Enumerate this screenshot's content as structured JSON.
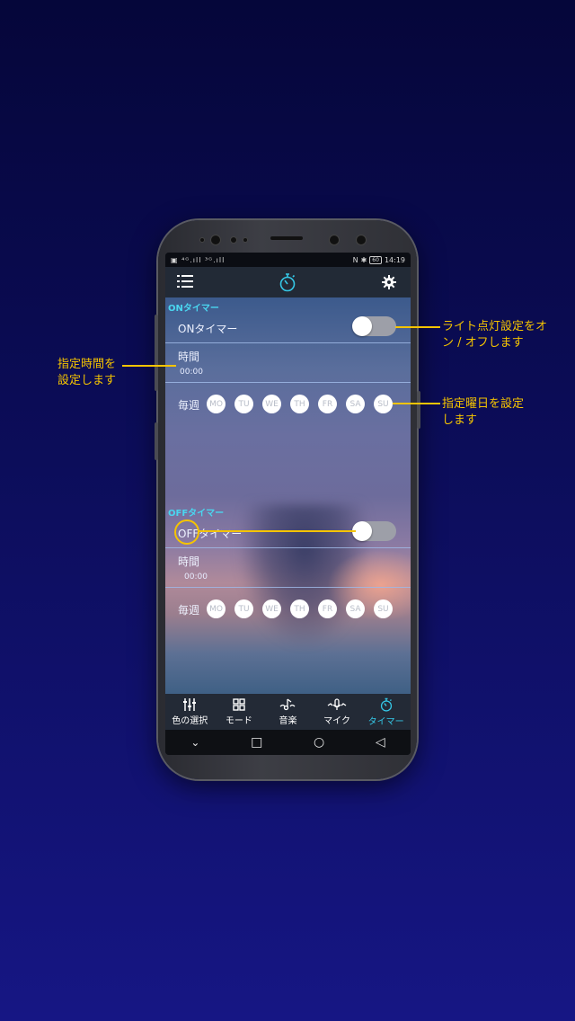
{
  "status_bar": {
    "time": "14:19",
    "battery": "60"
  },
  "app_bar": {
    "menu_icon": "list-icon",
    "title_icon": "stopwatch-icon",
    "settings_icon": "gear-icon"
  },
  "on_timer": {
    "section_title": "ONタイマー",
    "toggle_label": "ONタイマー",
    "time_label": "時間",
    "time_value": "00:00",
    "weekly_label": "毎週",
    "days": [
      "MO",
      "TU",
      "WE",
      "TH",
      "FR",
      "SA",
      "SU"
    ]
  },
  "off_timer": {
    "section_title": "OFFタイマー",
    "toggle_label": "OFFタイマー",
    "time_label": "時間",
    "time_value": "00:00",
    "weekly_label": "毎週",
    "days": [
      "MO",
      "TU",
      "WE",
      "TH",
      "FR",
      "SA",
      "SU"
    ]
  },
  "bottom_nav": [
    {
      "label": "色の選択",
      "icon": "sliders-icon"
    },
    {
      "label": "モード",
      "icon": "grid-icon"
    },
    {
      "label": "音楽",
      "icon": "music-icon"
    },
    {
      "label": "マイク",
      "icon": "microphone-icon"
    },
    {
      "label": "タイマー",
      "icon": "stopwatch-icon"
    }
  ],
  "annotations": {
    "toggle": {
      "line1": "ライト点灯設定をオ",
      "line2": "ン / オフします"
    },
    "time": {
      "line1": "指定時間を",
      "line2": "設定します"
    },
    "weekday": {
      "line1": "指定曜日を設定",
      "line2": "します"
    }
  },
  "colors": {
    "accent": "#35c7e6",
    "annotation": "#f5c400",
    "section_header": "#4ad6f0"
  }
}
